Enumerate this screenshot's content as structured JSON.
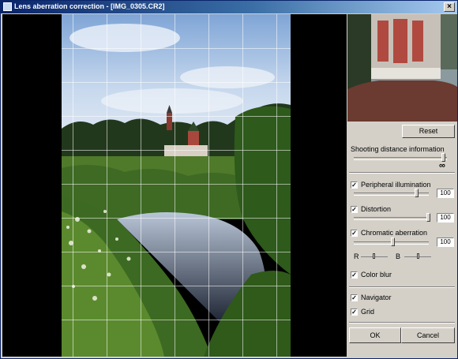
{
  "window": {
    "title": "Lens aberration correction - [IMG_0305.CR2]",
    "close_glyph": "×"
  },
  "panel": {
    "reset_label": "Reset",
    "shooting_distance_label": "Shooting distance information",
    "shooting_distance_level": 1.0,
    "infinity_symbol": "∞",
    "peripheral": {
      "label": "Peripheral illumination",
      "checked": true,
      "value": "100"
    },
    "distortion": {
      "label": "Distortion",
      "checked": true,
      "value": "100"
    },
    "chromatic": {
      "label": "Chromatic aberration",
      "checked": true,
      "value": "100",
      "r_label": "R",
      "b_label": "B"
    },
    "color_blur": {
      "label": "Color blur",
      "checked": true
    },
    "navigator": {
      "label": "Navigator",
      "checked": true
    },
    "grid": {
      "label": "Grid",
      "checked": true
    },
    "check_glyph": "✓",
    "ok_label": "OK",
    "cancel_label": "Cancel"
  }
}
